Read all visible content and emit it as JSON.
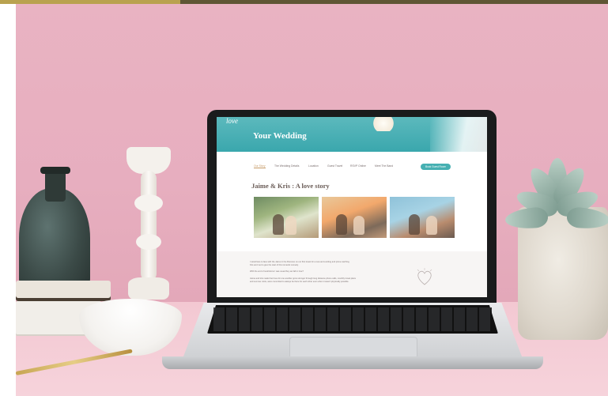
{
  "screen_site": {
    "logo": "love",
    "hero_title": "Your Wedding",
    "nav": [
      "Our Story",
      "The Wedding Details",
      "Location",
      "Guest Travel",
      "RSVP Online",
      "Meet The Band"
    ],
    "nav_button": "Book Guest Room",
    "story_title": "Jaime & Kris : A love story",
    "paragraphs": [
      "I stood face to face with the Jaime in the Florence on our first travel for a new and exciting and prime catching",
      "Kris and met to give the start of this romantic comedy.",
      "With the end of restrictions I was usual they set fall in love?",
      "Jaime and kris made their love for one another grow stronger through long distance phone calls, monthly travel plans",
      "and summer visits, were committed to always be there for each other even when it wasn't physically possible."
    ]
  },
  "colors": {
    "wall": "#e7aebf",
    "hero_teal": "#3aa7ad",
    "button_teal": "#46b0b2",
    "accent_gold": "#c59a66"
  }
}
